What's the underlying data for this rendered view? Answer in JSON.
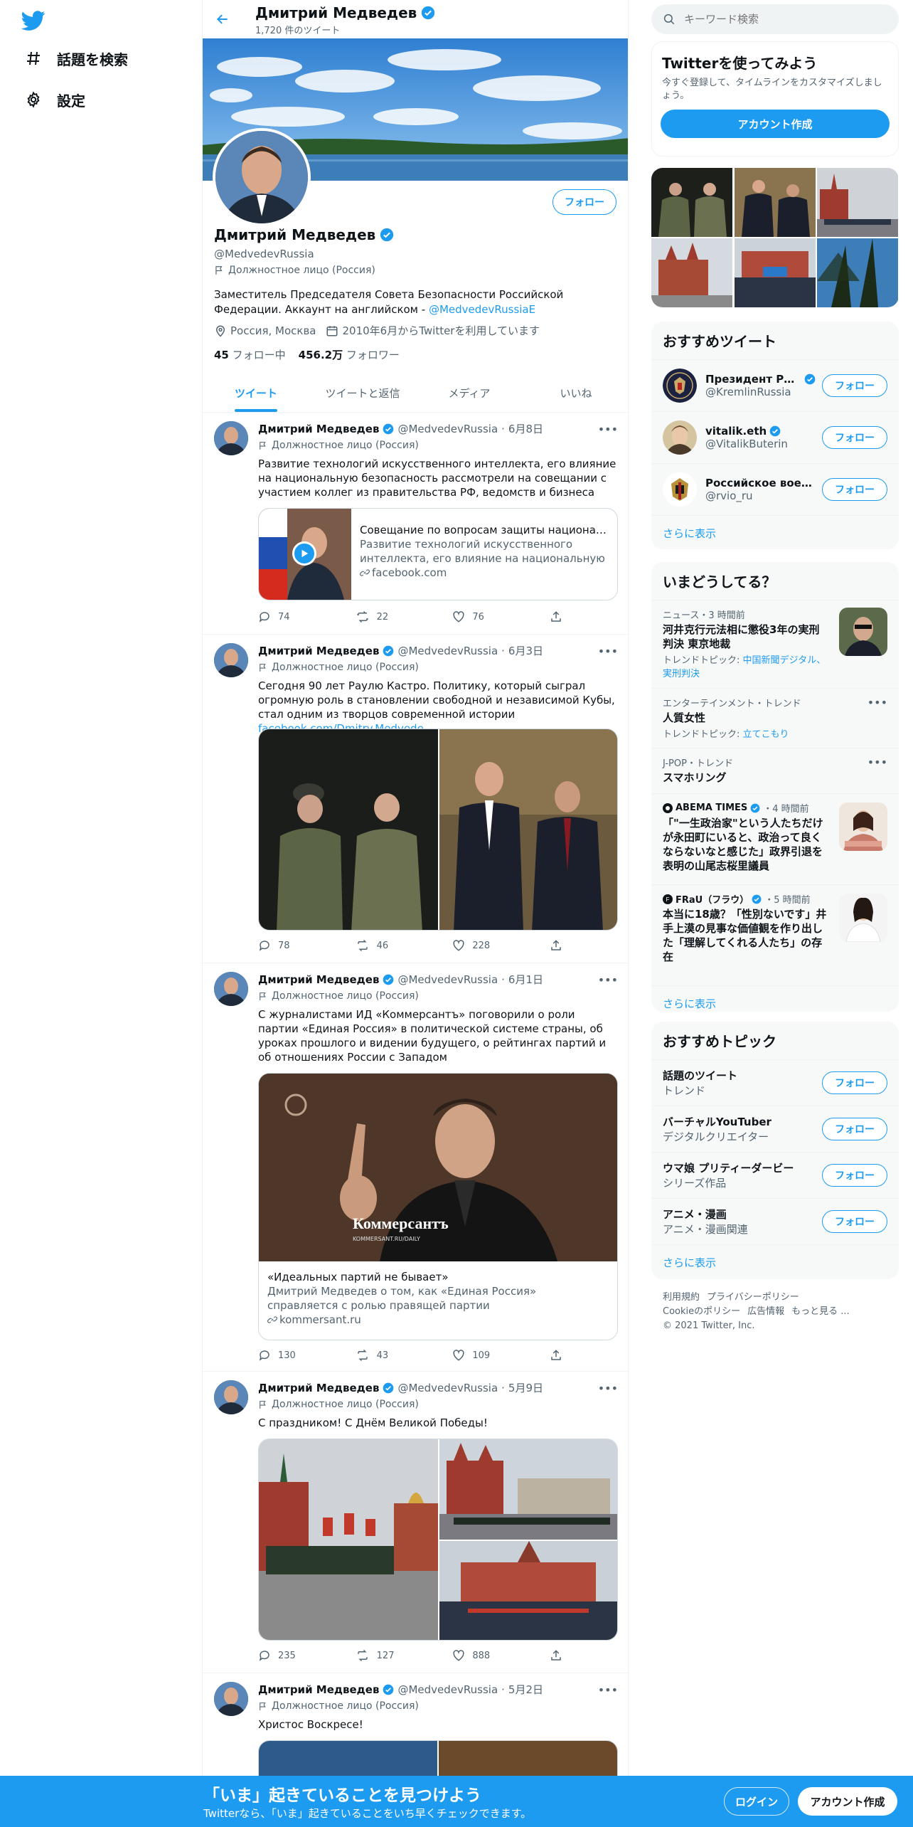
{
  "nav": {
    "explore_label": "話題を検索",
    "settings_label": "設定"
  },
  "profile": {
    "name": "Дмитрий Медведев",
    "tweet_count": "1,720 件のツイート",
    "handle": "@MedvedevRussia",
    "label": "Должностное лицо (Россия)",
    "bio_text": "Заместитель Председателя Совета Безопасности Российской Федерации. Аккаунт на английском - ",
    "bio_link": "@MedvedevRussiaE",
    "location": "Россия, Москва",
    "joined": "2010年6月からTwitterを利用しています",
    "following_count": "45",
    "following_label": "フォロー中",
    "followers_count": "456.2万",
    "followers_label": "フォロワー",
    "follow_label": "フォロー"
  },
  "tabs": [
    "ツイート",
    "ツイートと返信",
    "メディア",
    "いいね"
  ],
  "tweets": [
    {
      "name": "Дмитрий Медведев",
      "handle": "@MedvedevRussia",
      "date": "6月8日",
      "label": "Должностное лицо (Россия)",
      "text": "Развитие технологий искусственного интеллекта, его влияние на национальную безопасность рассмотрели на совещании с участием коллег из правительства РФ, ведомств и бизнеса",
      "card": {
        "title": "Совещание по вопросам защиты национальных интересов в информационной сфере",
        "desc": "Развитие технологий искусственного интеллекта, его влияние на национальную безопасность ...",
        "domain": "facebook.com"
      },
      "replies": "74",
      "retweets": "22",
      "likes": "76"
    },
    {
      "name": "Дмитрий Медведев",
      "handle": "@MedvedevRussia",
      "date": "6月3日",
      "label": "Должностное лицо (Россия)",
      "text": "Сегодня 90 лет Раулю Кастро. Политику, который сыграл огромную роль в становлении свободной и независимой Кубы, стал одним из творцов современной истории ",
      "link": "facebook.com/Dmitry.Medvede...",
      "replies": "78",
      "retweets": "46",
      "likes": "228"
    },
    {
      "name": "Дмитрий Медведев",
      "handle": "@MedvedevRussia",
      "date": "6月1日",
      "label": "Должностное лицо (Россия)",
      "text": "С журналистами ИД «Коммерсантъ» поговорили о роли партии «Единая Россия» в политической системе страны, об уроках прошлого и видении будущего, о рейтингах партий и об отношениях России с Западом",
      "card": {
        "image_text": "Коммерсантъ",
        "image_subtext": "KOMMERSANT.RU/DAILY",
        "title": "«Идеальных партий не бывает»",
        "desc": "Дмитрий Медведев о том, как «Единая Россия» справляется с ролью правящей партии",
        "domain": "kommersant.ru"
      },
      "replies": "130",
      "retweets": "43",
      "likes": "109"
    },
    {
      "name": "Дмитрий Медведев",
      "handle": "@MedvedevRussia",
      "date": "5月9日",
      "label": "Должностное лицо (Россия)",
      "text": "С праздником! С Днём Великой Победы!",
      "replies": "235",
      "retweets": "127",
      "likes": "888"
    },
    {
      "name": "Дмитрий Медведев",
      "handle": "@MedvedevRussia",
      "date": "5月2日",
      "label": "Должностное лицо (Россия)",
      "text": "Христос Воскресе!"
    }
  ],
  "right": {
    "search_placeholder": "キーワード検索",
    "signup_panel": {
      "title": "Twitterを使ってみよう",
      "desc": "今すぐ登録して、タイムラインをカスタマイズしましょう。",
      "button": "アカウント作成"
    },
    "who_to_follow": {
      "title": "おすすめツイート",
      "users": [
        {
          "name": "Президент России",
          "handle": "@KremlinRussia",
          "verified": true
        },
        {
          "name": "vitalik.eth",
          "handle": "@VitalikButerin",
          "verified": true
        },
        {
          "name": "Российское военное ист...",
          "handle": "@rvio_ru",
          "verified": false
        }
      ],
      "follow_label": "フォロー",
      "show_more": "さらに表示"
    },
    "trends": {
      "title": "いまどうしてる？",
      "items": [
        {
          "meta": "ニュース・3 時間前",
          "title": "河井克行元法相に懲役3年の実刑判決 東京地裁",
          "sub_prefix": "トレンドトピック: ",
          "sub_link": "中国新聞デジタル、実刑判決"
        },
        {
          "meta": "エンターテインメント・トレンド",
          "title": "人質女性",
          "sub_prefix": "トレンドトピック: ",
          "sub_link": "立てこもり"
        },
        {
          "meta": "J-POP・トレンド",
          "title": "スマホリング"
        },
        {
          "source": "ABEMA TIMES",
          "time": "・4 時間前",
          "title": "「\"一生政治家\"という人たちだけが永田町にいると、政治って良くならないなと感じた」政界引退を表明の山尾志桜里議員"
        },
        {
          "source": "FRaU（フラウ）",
          "time": "・5 時間前",
          "title": "本当に18歳？「性別ないです」井手上漠の見事な価値観を作り出した「理解してくれる人たち」の存在"
        }
      ],
      "show_more": "さらに表示"
    },
    "topics": {
      "title": "おすすめトピック",
      "items": [
        {
          "name": "話題のツイート",
          "category": "トレンド"
        },
        {
          "name": "バーチャルYouTuber",
          "category": "デジタルクリエイター"
        },
        {
          "name": "ウマ娘 プリティーダービー",
          "category": "シリーズ作品"
        },
        {
          "name": "アニメ・漫画",
          "category": "アニメ・漫画関連"
        }
      ],
      "follow_label": "フォロー",
      "show_more": "さらに表示"
    },
    "footer": {
      "links": [
        "利用規約",
        "プライバシーポリシー",
        "Cookieのポリシー",
        "広告情報",
        "もっと見る ..."
      ],
      "copyright": "© 2021 Twitter, Inc."
    }
  },
  "bottom_bar": {
    "title": "「いま」起きていることを見つけよう",
    "subtitle": "Twitterなら、「いま」起きていることをいち早くチェックできます。",
    "login": "ログイン",
    "signup": "アカウント作成"
  },
  "colors": {
    "accent": "#1d9bf0",
    "text": "#0f1419",
    "muted": "#536471"
  }
}
